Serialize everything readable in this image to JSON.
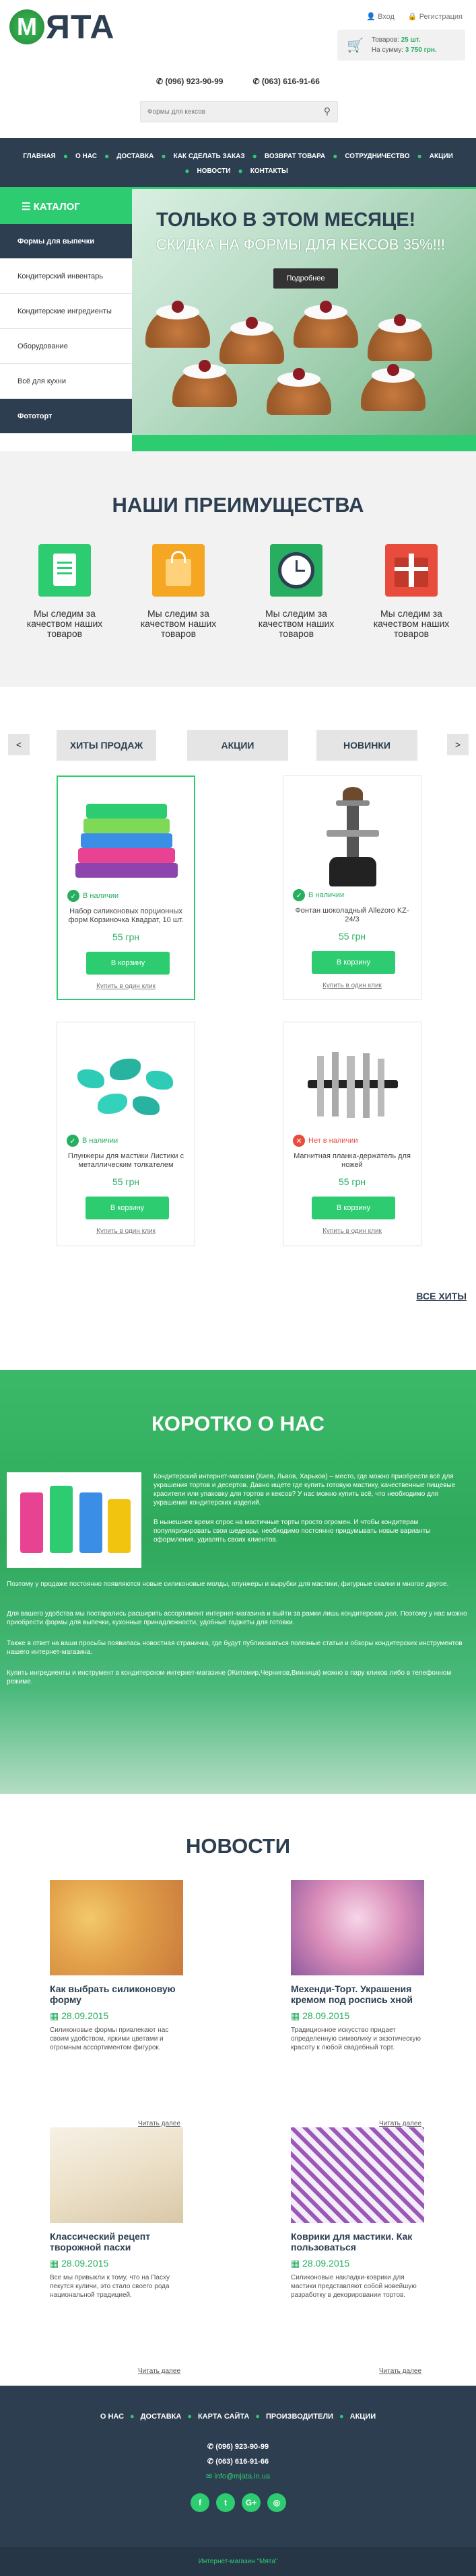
{
  "logo": {
    "letter": "М",
    "rest": "ЯТА"
  },
  "auth": {
    "login": "Вход",
    "register": "Регистрация"
  },
  "cart": {
    "goods_label": "Товаров:",
    "goods_count": "25 шт.",
    "sum_label": "На сумму:",
    "sum_value": "3 750 грн."
  },
  "phones": [
    "(096) 923-90-99",
    "(063) 616-91-66"
  ],
  "search": {
    "placeholder": "Формы для кексов"
  },
  "nav": {
    "row1": [
      "ГЛАВНАЯ",
      "О НАС",
      "ДОСТАВКА",
      "КАК СДЕЛАТЬ ЗАКАЗ",
      "ВОЗВРАТ ТОВАРА",
      "СОТРУДНИЧЕСТВО",
      "АКЦИИ"
    ],
    "row2": [
      "НОВОСТИ",
      "КОНТАКТЫ"
    ]
  },
  "catalog": {
    "title": "КАТАЛОГ",
    "items": [
      "Формы для выпечки",
      "Кондитерский инвентарь",
      "Кондитерские ингредиенты",
      "Оборудование",
      "Всё для кухни",
      "Фототорт"
    ]
  },
  "hero": {
    "title": "ТОЛЬКО В ЭТОМ МЕСЯЦЕ!",
    "subtitle": "СКИДКА НА ФОРМЫ ДЛЯ КЕКСОВ 35%!!!",
    "button": "Подробнее"
  },
  "advantages": {
    "title": "НАШИ ПРЕИМУЩЕСТВА",
    "items": [
      {
        "text": "Мы следим за качеством наших товаров",
        "icon": "clipboard-icon",
        "color": "#2ecc71"
      },
      {
        "text": "Мы следим за качеством наших товаров",
        "icon": "shopping-bag-icon",
        "color": "#f5a623"
      },
      {
        "text": "Мы следим за качеством наших товаров",
        "icon": "clock-icon",
        "color": "#27ae60"
      },
      {
        "text": "Мы следим за качеством наших товаров",
        "icon": "gift-icon",
        "color": "#e74c3c"
      }
    ]
  },
  "hits": {
    "tabs": [
      "ХИТЫ ПРОДАЖ",
      "АКЦИИ",
      "НОВИНКИ"
    ],
    "prev": "<",
    "next": ">",
    "products": [
      {
        "stock": "В наличии",
        "in_stock": true,
        "name": "Набор силиконовых порционных форм Корзиночка Квадрат, 10 шт.",
        "price": "55 грн",
        "buy": "В корзину",
        "one_click": "Купить в один клик"
      },
      {
        "stock": "В наличии",
        "in_stock": true,
        "name": "Фонтан шоколадный Allezoro KZ-24/3",
        "price": "55 грн",
        "buy": "В корзину",
        "one_click": "Купить в один клик"
      },
      {
        "stock": "В наличии",
        "in_stock": true,
        "name": "Плунжеры для мастики Листики с металлическим толкателем",
        "price": "55 грн",
        "buy": "В корзину",
        "one_click": "Купить в один клик"
      },
      {
        "stock": "Нет в наличии",
        "in_stock": false,
        "name": "Магнитная планка-держатель для ножей",
        "price": "55 грн",
        "buy": "В корзину",
        "one_click": "Купить в один клик"
      }
    ],
    "all": "ВСЕ ХИТЫ"
  },
  "about": {
    "title": "КОРОТКО О НАС",
    "p1": "Кондитерский интернет-магазин (Киев, Львов, Харьков) – место, где можно приобрести всё для украшения тортов и десертов. Давно ищете где купить готовую мастику, качественные пищевые красители или упаковку для тортов и кексов? У нас можно купить всё, что необходимо для украшения кондитерских изделий.",
    "p2": "В нынешнее время спрос на мастичные торты просто огромен. И чтобы кондитерам популяризировать свои шедевры, необходимо постоянно придумывать новые варианты оформления, удивлять своих клиентов.",
    "p3": "Поэтому у продаже постоянно появляются новые силиконовые молды, плунжеры и вырубки для мастики, фигурные скалки и многое другое.",
    "p4": "Для вашего удобства мы постарались расширить ассортимент интернет-магазина и выйти за рамки лишь кондитерских дел. Поэтому у нас можно приобрести формы для выпечки, кухонные принадлежности, удобные гаджеты для готовки.",
    "p5": "Также в ответ на ваши просьбы появилась новостная страничка, где будут публиковаться полезные статьи и обзоры кондитерских инструментов нашего интернет-магазина.",
    "p6": "Купить ингредиенты и инструмент в кондитерском интернет-магазине (Житомир,Чернигов,Винница) можно в пару кликов либо в телефонном режиме."
  },
  "news": {
    "title": "НОВОСТИ",
    "items": [
      {
        "title": "Как выбрать силиконовую форму",
        "date": "28.09.2015",
        "text": "Силиконовые формы привлекают нас своим удобством, яркими цветами и огромным ассортиментом фигурок.",
        "more": "Читать далее"
      },
      {
        "title": "Мехенди-Торт. Украшения кремом под роспись хной",
        "date": "28.09.2015",
        "text": "Традиционное искусство придает определенную символику и экзотическую красоту к любой свадебный торт.",
        "more": "Читать далее"
      },
      {
        "title": "Классический рецепт творожной пасхи",
        "date": "28.09.2015",
        "text": "Все мы привыкли к тому, что на Пасху пекутся куличи, это стало своего рода национальной традицией.",
        "more": "Читать далее"
      },
      {
        "title": "Коврики для мастики. Как пользоваться",
        "date": "28.09.2015",
        "text": "Силиконовые накладки-коврики для мастики представляют собой новейшую разработку в декорировании тортов.",
        "more": "Читать далее"
      }
    ]
  },
  "footer": {
    "menu": [
      "О НАС",
      "ДОСТАВКА",
      "КАРТА САЙТА",
      "ПРОИЗВОДИТЕЛИ",
      "АКЦИИ"
    ],
    "phone1": "(096) 923-90-99",
    "phone2": "(063) 616-91-66",
    "email": "info@mjata.in.ua",
    "social": [
      "f",
      "t",
      "G+",
      "◎"
    ],
    "copyright": "Интернет-магазин \"Мята\""
  },
  "colors": {
    "brand": "#2ecc71",
    "dark": "#2c3e50"
  }
}
